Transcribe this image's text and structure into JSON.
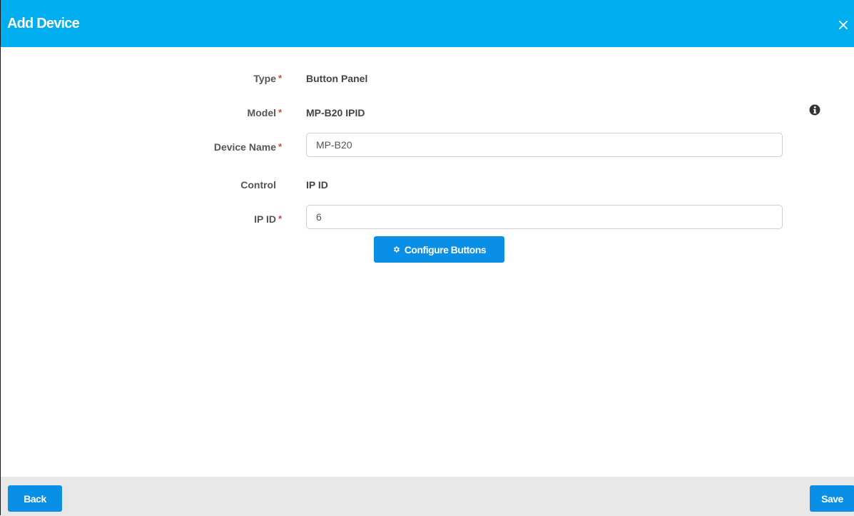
{
  "dialog": {
    "title": "Add Device",
    "close_icon": "close-icon"
  },
  "form": {
    "required_marker": "*",
    "type": {
      "label": "Type",
      "value": "Button Panel"
    },
    "model": {
      "label": "Model",
      "value": "MP-B20 IPID"
    },
    "device_name": {
      "label": "Device Name",
      "value": "MP-B20"
    },
    "control": {
      "label": "Control",
      "value": "IP ID"
    },
    "ip_id": {
      "label": "IP ID",
      "value": "6"
    },
    "info_icon": "info-icon",
    "configure_button": {
      "label": "Configure Buttons",
      "icon": "gear-icon"
    }
  },
  "footer": {
    "back_label": "Back",
    "save_label": "Save"
  },
  "colors": {
    "header": "#00aeef",
    "button": "#0a8fe6",
    "required": "#e0413b",
    "footer": "#e8e8e8"
  }
}
